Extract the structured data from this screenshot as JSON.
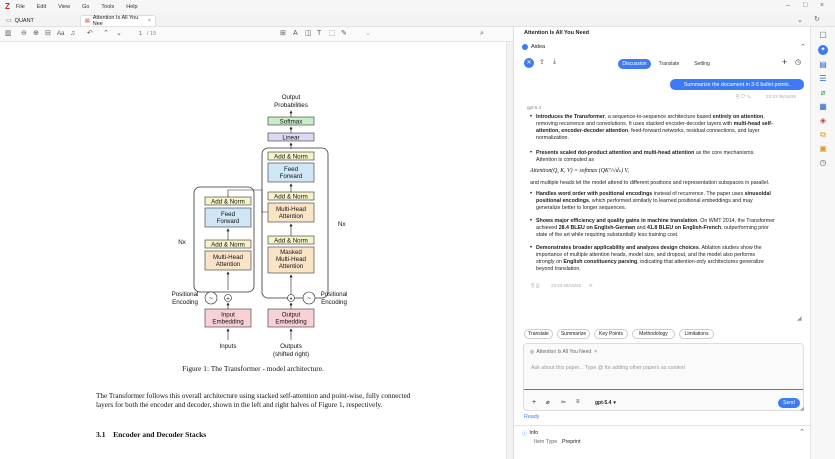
{
  "menu": {
    "logo": "Z",
    "items": [
      "File",
      "Edit",
      "View",
      "Go",
      "Tools",
      "Help"
    ]
  },
  "tabs": {
    "library": "QUANT",
    "paper": "Attention Is All You Nee"
  },
  "toolbar": {
    "page": "1",
    "page_total": "/ 15"
  },
  "doc": {
    "labels": {
      "output_probs_1": "Output",
      "output_probs_2": "Probabilities",
      "softmax": "Softmax",
      "linear": "Linear",
      "addnorm": "Add & Norm",
      "ff1": "Feed",
      "ff2": "Forward",
      "mh1": "Multi-Head",
      "mh2": "Attention",
      "masked1": "Masked",
      "masked2": "Multi-Head",
      "masked3": "Attention",
      "nx": "Nx",
      "pos1": "Positional",
      "pos2": "Encoding",
      "inemb1": "Input",
      "inemb2": "Embedding",
      "outemb1": "Output",
      "outemb2": "Embedding",
      "inputs": "Inputs",
      "outputs1": "Outputs",
      "outputs2": "(shifted right)"
    },
    "caption": "Figure 1: The Transformer - model architecture.",
    "para": "The Transformer follows this overall architecture using stacked self-attention and point-wise, fully connected layers for both the encoder and decoder, shown in the left and right halves of Figure 1, respectively.",
    "section": "3.1    Encoder and Decoder Stacks"
  },
  "panel": {
    "title": "Attention Is All You Need",
    "section": "Aidea",
    "tabs": [
      "Discussion",
      "Translate",
      "Setting"
    ],
    "user_msg": "Summarize the document in 3-5 bullet points.",
    "time1": "23:43 06/16/26",
    "model": "gpt-5.4",
    "bullets": [
      {
        "b": "Introduces the Transformer",
        "t1": ", a sequence-to-sequence architecture based ",
        "b2": "entirely on attention",
        "t2": ",",
        "l2": "removing recurrence and convolutions. It uses stacked encoder-decoder layers with ",
        "b3": "multi-head self-",
        "l3b": "attention, encoder-decoder attention",
        "l3": ", feed-forward networks, residual connections, and layer",
        "l4": "normalization."
      },
      {
        "b": "Presents scaled dot-product attention and multi-head attention",
        "t1": " as the core mechanisms.",
        "l2": "Attention is computed as"
      }
    ],
    "formula": "Attention(Q, K, V) = softmax (QKᵀ/√dₖ) V,",
    "formula_cont": "and multiple heads let the model attend to different positions and representation subspaces in parallel.",
    "b3": {
      "b1": "Handles word order with positional encodings",
      "t1": " instead of recurrence. The paper uses ",
      "b2": "sinusoidal",
      "l2b": "positional encodings",
      "l2": ", which performed similarly to learned positional embeddings and may",
      "l3": "generalize better to longer sequences."
    },
    "b4": {
      "b1": "Shows major efficiency and quality gains in machine translation",
      "t1": ". On WMT 2014, the Transformer",
      "l2a": "achieved ",
      "b2": "28.4 BLEU on English-German",
      "l2c": " and ",
      "b3": "41.8 BLEU on English-French",
      "l2d": ", outperforming prior",
      "l3": "state of the art while requiring substantially less training cost."
    },
    "b5": {
      "b1": "Demonstrates broader applicability and analyzes design choices",
      "t1": ". Ablation studies show the",
      "l2": "importance of multiple attention heads, model size, and dropout, and the model also performs",
      "l3a": "strongly on ",
      "b2": "English constituency parsing",
      "l3c": ", indicating that attention-only architectures generalize",
      "l4": "beyond translation."
    },
    "time2": "23:43 06/16/26",
    "chips": [
      "Translate",
      "Summarize",
      "Key Points",
      "Methodology",
      "Limitations"
    ],
    "context_tag": "Attention Is All You Need",
    "input_placeholder": "Ask about this paper... Type @ for adding other papers as context",
    "model_select": "gpt-5.4",
    "send": "Send",
    "status": "Ready",
    "info": "Info",
    "item_type_label": "Item Type",
    "item_type_value": "Preprint"
  },
  "colors": {
    "accent": "#3d7bf5",
    "encoder_blue": "#cfe3f7",
    "masked_orange": "#fbe3c6",
    "ffn_blue": "#cfe6f7",
    "addnorm_yellow": "#f5f3c8",
    "softmax_green": "#c9ecc9",
    "linear_purple": "#dcd9f2",
    "emb_pink": "#f7d1d4"
  }
}
